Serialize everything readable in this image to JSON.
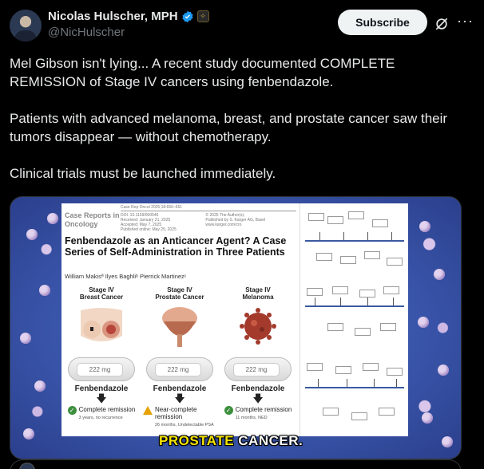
{
  "author": {
    "display_name": "Nicolas Hulscher, MPH",
    "handle": "@NicHulscher",
    "verified_icon": "verified-badge-icon",
    "affiliation_icon": "affiliation-badge-icon"
  },
  "actions": {
    "subscribe_label": "Subscribe",
    "grok_icon": "grok-icon",
    "more_icon": "more-icon"
  },
  "tweet": {
    "paragraphs": [
      "Mel Gibson isn't lying... A recent study documented COMPLETE REMISSION of Stage IV cancers using fenbendazole.",
      "Patients with advanced melanoma, breast, and prostate cancer saw their tumors disappear — without chemotherapy.",
      "Clinical trials must be launched immediately."
    ]
  },
  "media": {
    "journal": "Case Reports in Oncology",
    "meta_left": [
      "Case Rep Oncol 2025;18:650–661",
      "DOI: 10.1159/000546",
      "Received: January 21, 2025",
      "Accepted: May 7, 2025",
      "Published online: May 25, 2025"
    ],
    "meta_right": [
      "© 2025 The Author(s).",
      "Published by S. Karger AG, Basel",
      "www.karger.com/cro"
    ],
    "article_title": "Fenbendazole as an Anticancer Agent? A Case Series of Self-Administration in Three Patients",
    "authors": "William Makisª   Ilyes Baghliᵇ   Pierrick Martinezᶜ",
    "pill_text": "222   mg",
    "panels": [
      {
        "title": "Stage IV\nBreast Cancer",
        "drug": "Fenbendazole",
        "outcome": "Complete remission",
        "sub": "3 years, no recurrence",
        "status": "complete"
      },
      {
        "title": "Stage IV\nProstate Cancer",
        "drug": "Fenbendazole",
        "outcome": "Near-complete remission",
        "sub": "26 months, Undetectable PSA",
        "status": "near"
      },
      {
        "title": "Stage IV\nMelanoma",
        "drug": "Fenbendazole",
        "outcome": "Complete remission",
        "sub": "11 months, NED",
        "status": "complete"
      }
    ],
    "caption_highlight": "PROSTATE",
    "caption_rest": " CANCER."
  }
}
